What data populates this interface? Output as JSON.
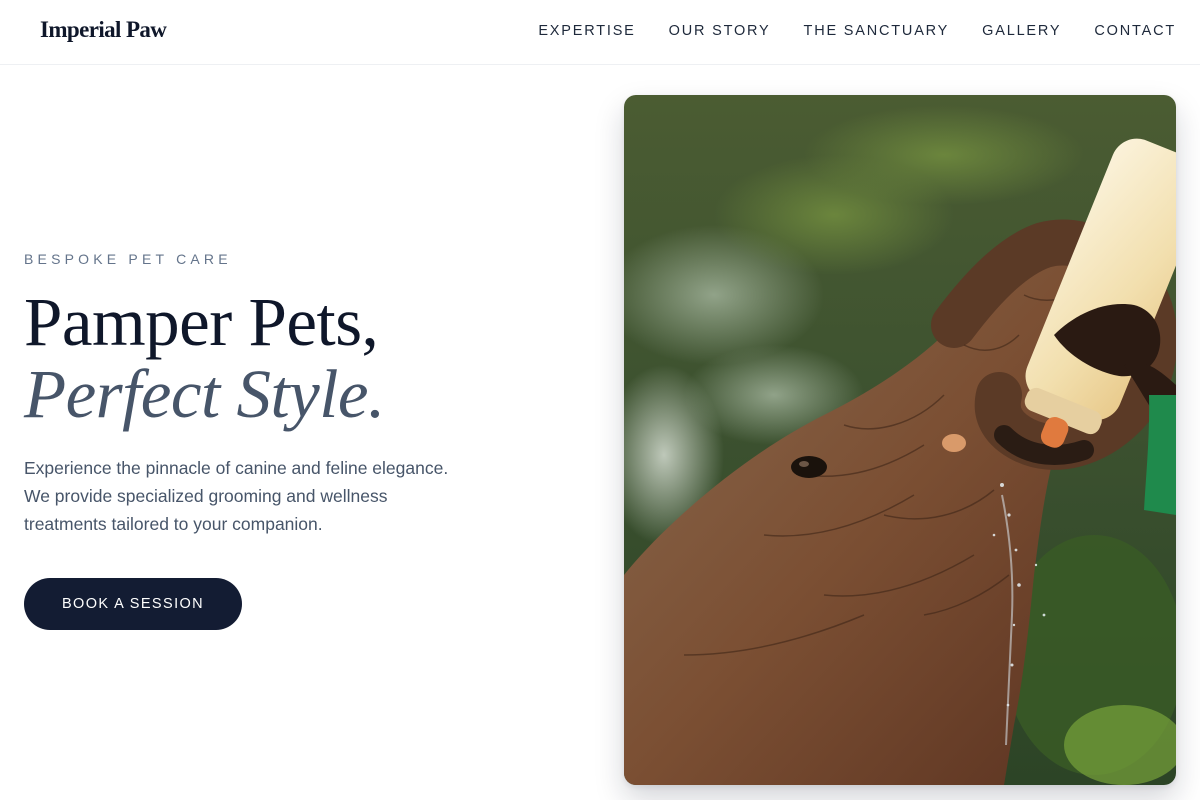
{
  "brand": {
    "name": "Imperial Paw"
  },
  "nav": {
    "items": [
      {
        "label": "EXPERTISE"
      },
      {
        "label": "OUR STORY"
      },
      {
        "label": "THE SANCTUARY"
      },
      {
        "label": "GALLERY"
      },
      {
        "label": "CONTACT"
      }
    ]
  },
  "hero": {
    "eyebrow": "BESPOKE PET CARE",
    "headline_line1": "Pamper Pets,",
    "headline_line2": "Perfect Style.",
    "description": "Experience the pinnacle of canine and feline elegance. We provide specialized grooming and wellness treatments tailored to your companion.",
    "cta_label": "BOOK A SESSION"
  },
  "image": {
    "subject": "baby elephant drinking from a milk bottle held by a keeper"
  },
  "colors": {
    "primary_dark": "#131c33",
    "heading": "#0f172a",
    "muted": "#475569",
    "eyebrow": "#64748b"
  }
}
